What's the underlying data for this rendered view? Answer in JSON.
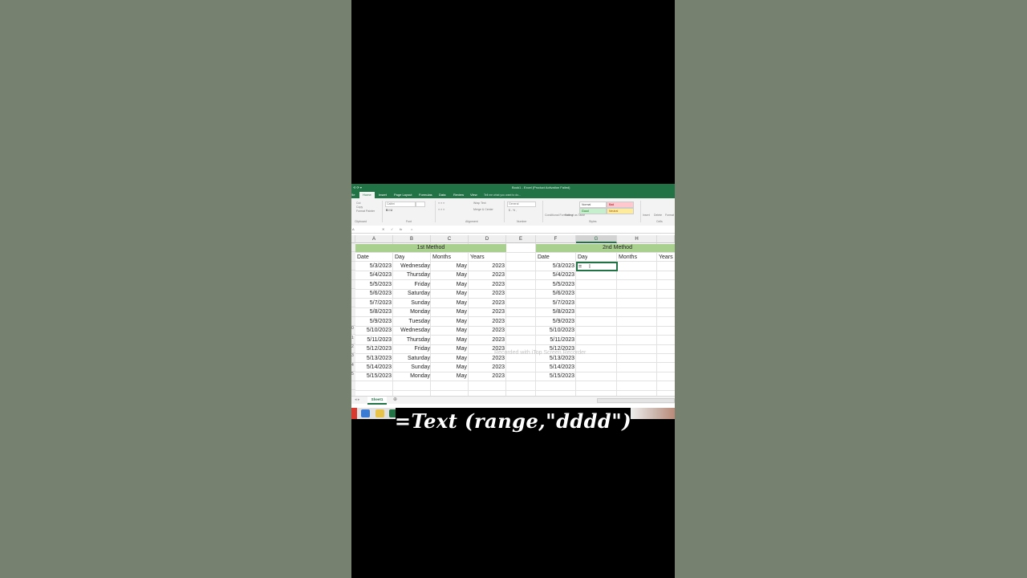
{
  "window": {
    "title": "Book1 - Excel (Product Activation Failed)"
  },
  "ribbon_tabs": [
    "File",
    "Home",
    "Insert",
    "Page Layout",
    "Formulas",
    "Data",
    "Review",
    "View"
  ],
  "active_tab": "Home",
  "tell_me": "Tell me what you want to do...",
  "ribbon": {
    "cut": "Cut",
    "copy": "Copy",
    "format_painter": "Format Painter",
    "font": "Calibri",
    "wrap_text": "Wrap Text",
    "merge_center": "Merge & Center",
    "number_format": "General",
    "cond_format": "Conditional Formatting",
    "format_as_table": "Format as Table",
    "styles": [
      "Normal",
      "Bad",
      "Good",
      "Neutral"
    ],
    "insert": "Insert",
    "delete": "Delete",
    "format": "Format",
    "groups": [
      "Clipboard",
      "Font",
      "Alignment",
      "Number",
      "Styles",
      "Cells"
    ]
  },
  "formula_bar": {
    "name_box": "A",
    "cancel": "✕",
    "enter": "✓",
    "fx": "fx",
    "formula": "="
  },
  "columns": [
    "A",
    "B",
    "C",
    "D",
    "E",
    "F",
    "G",
    "H"
  ],
  "row_numbers": [
    "",
    "",
    "",
    "",
    "",
    "",
    "",
    "",
    "",
    "0",
    "1",
    "2",
    "3",
    "4",
    "5",
    "",
    ""
  ],
  "section1": {
    "title": "1st Method",
    "headers": [
      "Date",
      "Day",
      "Months",
      "Years"
    ],
    "rows": [
      [
        "5/3/2023",
        "Wednesday",
        "May",
        "2023"
      ],
      [
        "5/4/2023",
        "Thursday",
        "May",
        "2023"
      ],
      [
        "5/5/2023",
        "Friday",
        "May",
        "2023"
      ],
      [
        "5/6/2023",
        "Saturday",
        "May",
        "2023"
      ],
      [
        "5/7/2023",
        "Sunday",
        "May",
        "2023"
      ],
      [
        "5/8/2023",
        "Monday",
        "May",
        "2023"
      ],
      [
        "5/9/2023",
        "Tuesday",
        "May",
        "2023"
      ],
      [
        "5/10/2023",
        "Wednesday",
        "May",
        "2023"
      ],
      [
        "5/11/2023",
        "Thursday",
        "May",
        "2023"
      ],
      [
        "5/12/2023",
        "Friday",
        "May",
        "2023"
      ],
      [
        "5/13/2023",
        "Saturday",
        "May",
        "2023"
      ],
      [
        "5/14/2023",
        "Sunday",
        "May",
        "2023"
      ],
      [
        "5/15/2023",
        "Monday",
        "May",
        "2023"
      ]
    ]
  },
  "section2": {
    "title": "2nd Method",
    "headers": [
      "Date",
      "Day",
      "Months",
      "Years"
    ],
    "dates": [
      "5/3/2023",
      "5/4/2023",
      "5/5/2023",
      "5/6/2023",
      "5/7/2023",
      "5/8/2023",
      "5/9/2023",
      "5/10/2023",
      "5/11/2023",
      "5/12/2023",
      "5/13/2023",
      "5/14/2023",
      "5/15/2023"
    ],
    "active_cell_value": "="
  },
  "watermark": "Recorded with iTop Screen Recorder",
  "sheet_tab": "Sheet1",
  "caption": "=Text (range,\"dddd\")",
  "colors": {
    "excel_green": "#217346",
    "band_green": "#a9d08e",
    "backdrop": "#778170"
  }
}
